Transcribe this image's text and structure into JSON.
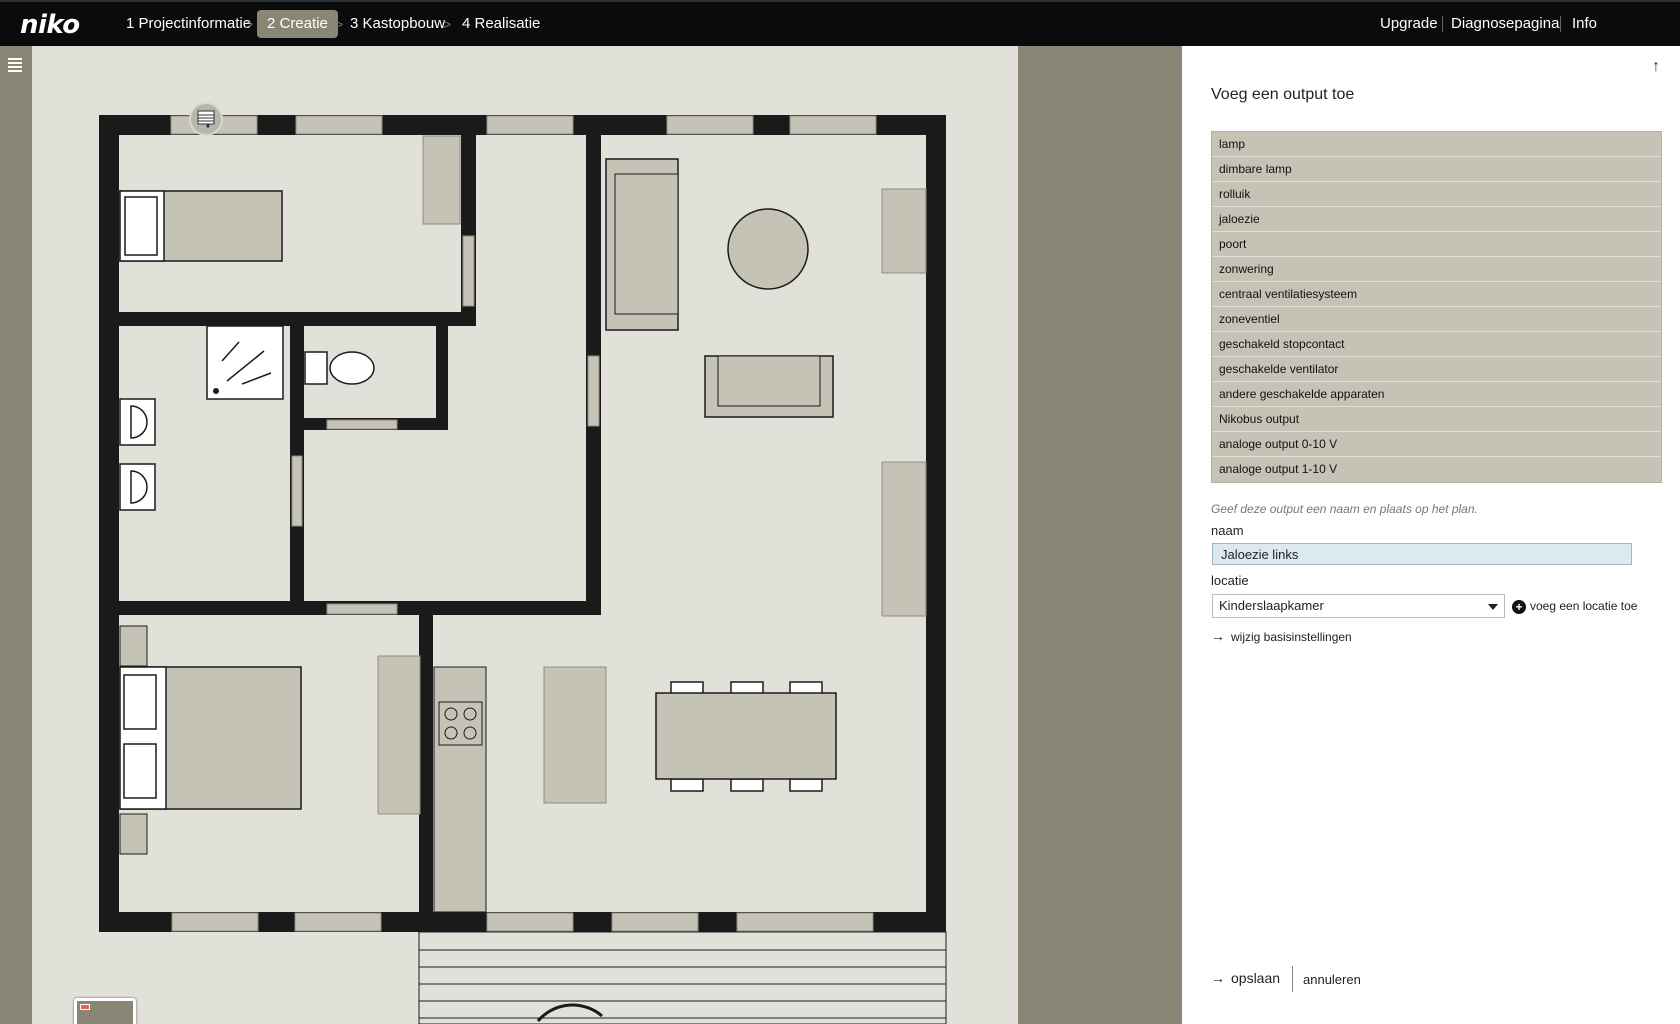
{
  "header": {
    "logo": "niko",
    "steps": [
      {
        "label": "1 Projectinformatie",
        "active": false
      },
      {
        "label": "2 Creatie",
        "active": true
      },
      {
        "label": "3 Kastopbouw",
        "active": false
      },
      {
        "label": "4 Realisatie",
        "active": false
      }
    ],
    "links": [
      "Upgrade",
      "Diagnosepagina",
      "Info"
    ]
  },
  "sidebar": {
    "icon": "menu-list-icon"
  },
  "plan": {
    "placed_icon": "blind-icon",
    "minimap_icon": "minimap-icon"
  },
  "panel": {
    "title": "Voeg een output toe",
    "outputs": [
      "lamp",
      "dimbare lamp",
      "rolluik",
      "jaloezie",
      "poort",
      "zonwering",
      "centraal ventilatiesysteem",
      "zoneventiel",
      "geschakeld stopcontact",
      "geschakelde ventilator",
      "andere geschakelde apparaten",
      "Nikobus output",
      "analoge output 0-10 V",
      "analoge output 1-10 V"
    ],
    "hint": "Geef deze output een naam en plaats op het plan.",
    "naam_label": "naam",
    "naam_value": "Jaloezie links",
    "locatie_label": "locatie",
    "locatie_value": "Kinderslaapkamer",
    "add_location": "voeg een locatie toe",
    "basis_link": "wijzig basisinstellingen",
    "save": "opslaan",
    "cancel": "annuleren"
  },
  "colors": {
    "topbar": "#0b0b0b",
    "accent": "#8a8676",
    "canvas": "#e1e1da",
    "wall": "#1a1a1a",
    "furniture": "#c4c3b6",
    "list_bg": "#c4c3b6",
    "input_bg": "#dde9f0"
  }
}
